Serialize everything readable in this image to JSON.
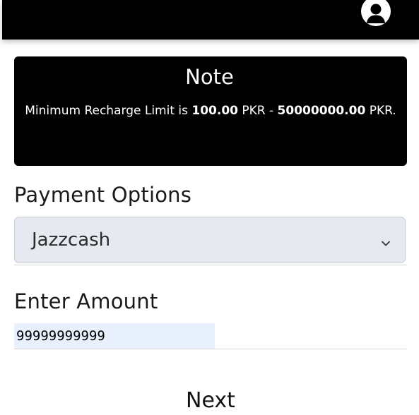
{
  "note": {
    "title": "Note",
    "text_before": "Minimum Recharge Limit is ",
    "min_amount": "100.00",
    "text_mid": " PKR - ",
    "max_amount": "50000000.00",
    "text_after": " PKR."
  },
  "payment": {
    "label": "Payment Options",
    "selected": "Jazzcash"
  },
  "amount": {
    "label": "Enter Amount",
    "value": "99999999999"
  },
  "actions": {
    "next_label": "Next"
  },
  "icons": {
    "profile": "user-avatar-icon",
    "dropdown": "chevron-down-icon"
  }
}
